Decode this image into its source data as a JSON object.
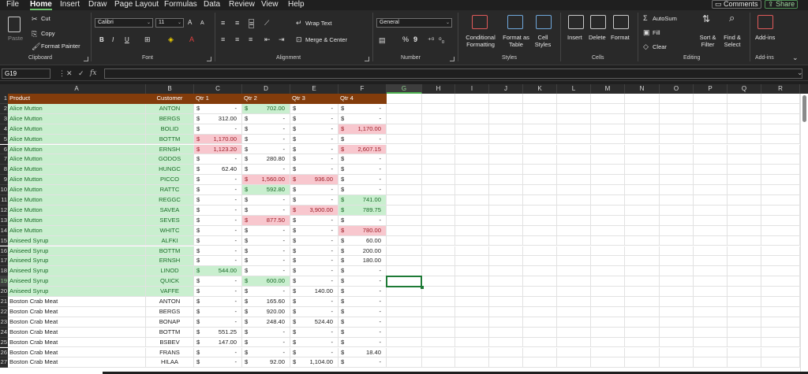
{
  "menu": {
    "tabs": [
      "File",
      "Home",
      "Insert",
      "Draw",
      "Page Layout",
      "Formulas",
      "Data",
      "Review",
      "View",
      "Help"
    ],
    "active": "Home",
    "comments_label": "Comments",
    "share_label": "Share"
  },
  "ribbon": {
    "clipboard": {
      "paste": "Paste",
      "cut": "Cut",
      "copy": "Copy",
      "format_painter": "Format Painter",
      "label": "Clipboard"
    },
    "font": {
      "name": "Calibri",
      "size": "11",
      "bold": "B",
      "italic": "I",
      "underline": "U",
      "grow": "A",
      "shrink": "A",
      "label": "Font"
    },
    "alignment": {
      "wrap_text": "Wrap Text",
      "merge_center": "Merge & Center",
      "label": "Alignment"
    },
    "number": {
      "format": "General",
      "percent": "%",
      "comma": "9",
      "label": "Number"
    },
    "styles": {
      "conditional_formatting": "Conditional Formatting",
      "format_as_table": "Format as Table",
      "cell_styles": "Cell Styles",
      "label": "Styles"
    },
    "cells": {
      "insert": "Insert",
      "delete": "Delete",
      "format": "Format",
      "label": "Cells"
    },
    "editing": {
      "autosum": "AutoSum",
      "fill": "Fill",
      "clear": "Clear",
      "sort_filter": "Sort & Filter",
      "find_select": "Find & Select",
      "label": "Editing"
    },
    "addins": {
      "addins": "Add-ins",
      "label": "Add-ins"
    }
  },
  "formula_bar": {
    "name_box": "G19",
    "fx": "fx",
    "formula": ""
  },
  "columns": [
    "A",
    "B",
    "C",
    "D",
    "E",
    "F",
    "G",
    "H",
    "I",
    "J",
    "K",
    "L",
    "M",
    "N",
    "O",
    "P",
    "Q",
    "R"
  ],
  "selected_column": "G",
  "selected_row": "19",
  "header_row": {
    "row": "1",
    "cells": [
      "Product",
      "Customer",
      "Qtr 1",
      "Qtr 2",
      "Qtr 3",
      "Qtr 4"
    ]
  },
  "rows": [
    {
      "n": "2",
      "product": "Alice Mutton",
      "customer": "ANTON",
      "q": [
        "-",
        "702.00",
        "-",
        "-"
      ]
    },
    {
      "n": "3",
      "product": "Alice Mutton",
      "customer": "BERGS",
      "q": [
        "312.00",
        "-",
        "-",
        "-"
      ]
    },
    {
      "n": "4",
      "product": "Alice Mutton",
      "customer": "BOLID",
      "q": [
        "-",
        "-",
        "-",
        "1,170.00"
      ]
    },
    {
      "n": "5",
      "product": "Alice Mutton",
      "customer": "BOTTM",
      "q": [
        "1,170.00",
        "-",
        "-",
        "-"
      ]
    },
    {
      "n": "6",
      "product": "Alice Mutton",
      "customer": "ERNSH",
      "q": [
        "1,123.20",
        "-",
        "-",
        "2,607.15"
      ]
    },
    {
      "n": "7",
      "product": "Alice Mutton",
      "customer": "GODOS",
      "q": [
        "-",
        "280.80",
        "-",
        "-"
      ]
    },
    {
      "n": "8",
      "product": "Alice Mutton",
      "customer": "HUNGC",
      "q": [
        "62.40",
        "-",
        "-",
        "-"
      ]
    },
    {
      "n": "9",
      "product": "Alice Mutton",
      "customer": "PICCO",
      "q": [
        "-",
        "1,560.00",
        "936.00",
        "-"
      ]
    },
    {
      "n": "10",
      "product": "Alice Mutton",
      "customer": "RATTC",
      "q": [
        "-",
        "592.80",
        "-",
        "-"
      ]
    },
    {
      "n": "11",
      "product": "Alice Mutton",
      "customer": "REGGC",
      "q": [
        "-",
        "-",
        "-",
        "741.00"
      ]
    },
    {
      "n": "12",
      "product": "Alice Mutton",
      "customer": "SAVEA",
      "q": [
        "-",
        "-",
        "3,900.00",
        "789.75"
      ]
    },
    {
      "n": "13",
      "product": "Alice Mutton",
      "customer": "SEVES",
      "q": [
        "-",
        "877.50",
        "-",
        "-"
      ]
    },
    {
      "n": "14",
      "product": "Alice Mutton",
      "customer": "WHITC",
      "q": [
        "-",
        "-",
        "-",
        "780.00"
      ]
    },
    {
      "n": "15",
      "product": "Aniseed Syrup",
      "customer": "ALFKI",
      "q": [
        "-",
        "-",
        "-",
        "60.00"
      ]
    },
    {
      "n": "16",
      "product": "Aniseed Syrup",
      "customer": "BOTTM",
      "q": [
        "-",
        "-",
        "-",
        "200.00"
      ]
    },
    {
      "n": "17",
      "product": "Aniseed Syrup",
      "customer": "ERNSH",
      "q": [
        "-",
        "-",
        "-",
        "180.00"
      ]
    },
    {
      "n": "18",
      "product": "Aniseed Syrup",
      "customer": "LINOD",
      "q": [
        "544.00",
        "-",
        "-",
        "-"
      ]
    },
    {
      "n": "19",
      "product": "Aniseed Syrup",
      "customer": "QUICK",
      "q": [
        "-",
        "600.00",
        "-",
        "-"
      ]
    },
    {
      "n": "20",
      "product": "Aniseed Syrup",
      "customer": "VAFFE",
      "q": [
        "-",
        "-",
        "140.00",
        "-"
      ]
    },
    {
      "n": "21",
      "product": "Boston Crab Meat",
      "customer": "ANTON",
      "q": [
        "-",
        "165.60",
        "-",
        "-"
      ]
    },
    {
      "n": "22",
      "product": "Boston Crab Meat",
      "customer": "BERGS",
      "q": [
        "-",
        "920.00",
        "-",
        "-"
      ]
    },
    {
      "n": "23",
      "product": "Boston Crab Meat",
      "customer": "BONAP",
      "q": [
        "-",
        "248.40",
        "524.40",
        "-"
      ]
    },
    {
      "n": "24",
      "product": "Boston Crab Meat",
      "customer": "BOTTM",
      "q": [
        "551.25",
        "-",
        "-",
        "-"
      ]
    },
    {
      "n": "25",
      "product": "Boston Crab Meat",
      "customer": "BSBEV",
      "q": [
        "147.00",
        "-",
        "-",
        "-"
      ]
    },
    {
      "n": "26",
      "product": "Boston Crab Meat",
      "customer": "FRANS",
      "q": [
        "-",
        "-",
        "-",
        "18.40"
      ]
    },
    {
      "n": "27",
      "product": "Boston Crab Meat",
      "customer": "HILAA",
      "q": [
        "-",
        "92.00",
        "1,104.00",
        "-"
      ]
    }
  ],
  "highlights": {
    "red": [
      "5-0",
      "6-0",
      "9-1",
      "9-2",
      "12-2",
      "13-1",
      "4-3",
      "6-3",
      "14-3"
    ],
    "green": [
      "2-1",
      "10-1",
      "18-0",
      "19-1",
      "11-3",
      "12-3"
    ]
  },
  "green_product_rows_until": 20,
  "currency_symbol": "$",
  "colors": {
    "header_fill": "#833c0b",
    "accent": "#1e7a36",
    "red_fill": "#f8c7ce",
    "green_fill": "#c9efcf"
  }
}
